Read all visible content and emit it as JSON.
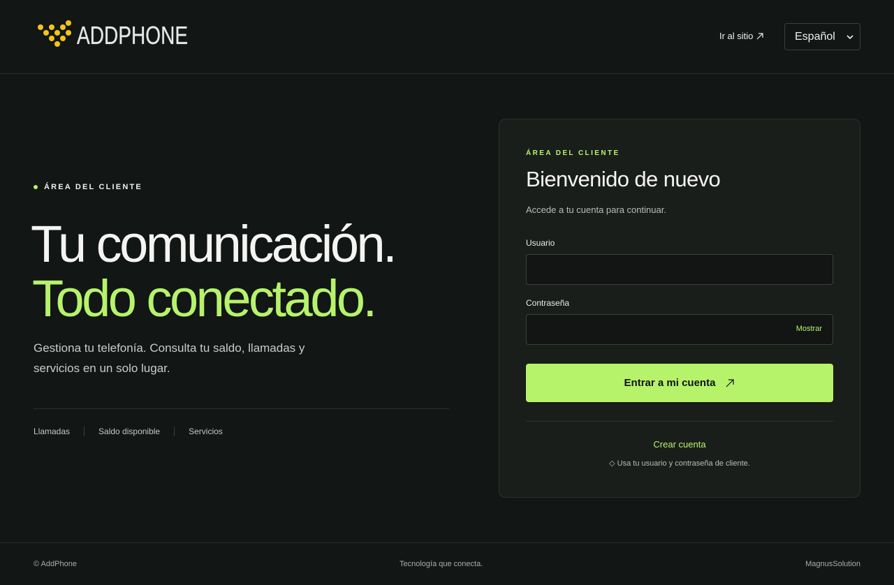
{
  "brand": {
    "logo_text": "ADDPHONE",
    "accent": "#b6f36b",
    "logo_color": "#f4c417"
  },
  "header": {
    "go_to_site": "Ir al sitio",
    "go_to_site_icon": "arrow-up-right-icon",
    "language": "Español"
  },
  "hero": {
    "eyebrow": "ÁREA DEL CLIENTE",
    "line1": "Tu comunicación.",
    "line2": "Todo conectado.",
    "description": "Gestiona tu telefonía. Consulta tu saldo, llamadas y servicios en un solo lugar.",
    "features": [
      "Llamadas",
      "Saldo disponible",
      "Servicios"
    ]
  },
  "login": {
    "eyebrow": "ÁREA DEL CLIENTE",
    "title": "Bienvenido de nuevo",
    "subtitle": "Accede a tu cuenta para continuar.",
    "username_label": "Usuario",
    "username_value": "",
    "password_label": "Contraseña",
    "password_value": "",
    "show_label": "Mostrar",
    "submit_label": "Entrar a mi cuenta",
    "create_account": "Crear cuenta",
    "hint": "◇ Usa tu usuario y contraseña de cliente."
  },
  "footer": {
    "copyright": "© AddPhone",
    "tagline": "Tecnología que conecta.",
    "credit": "MagnusSolution"
  }
}
